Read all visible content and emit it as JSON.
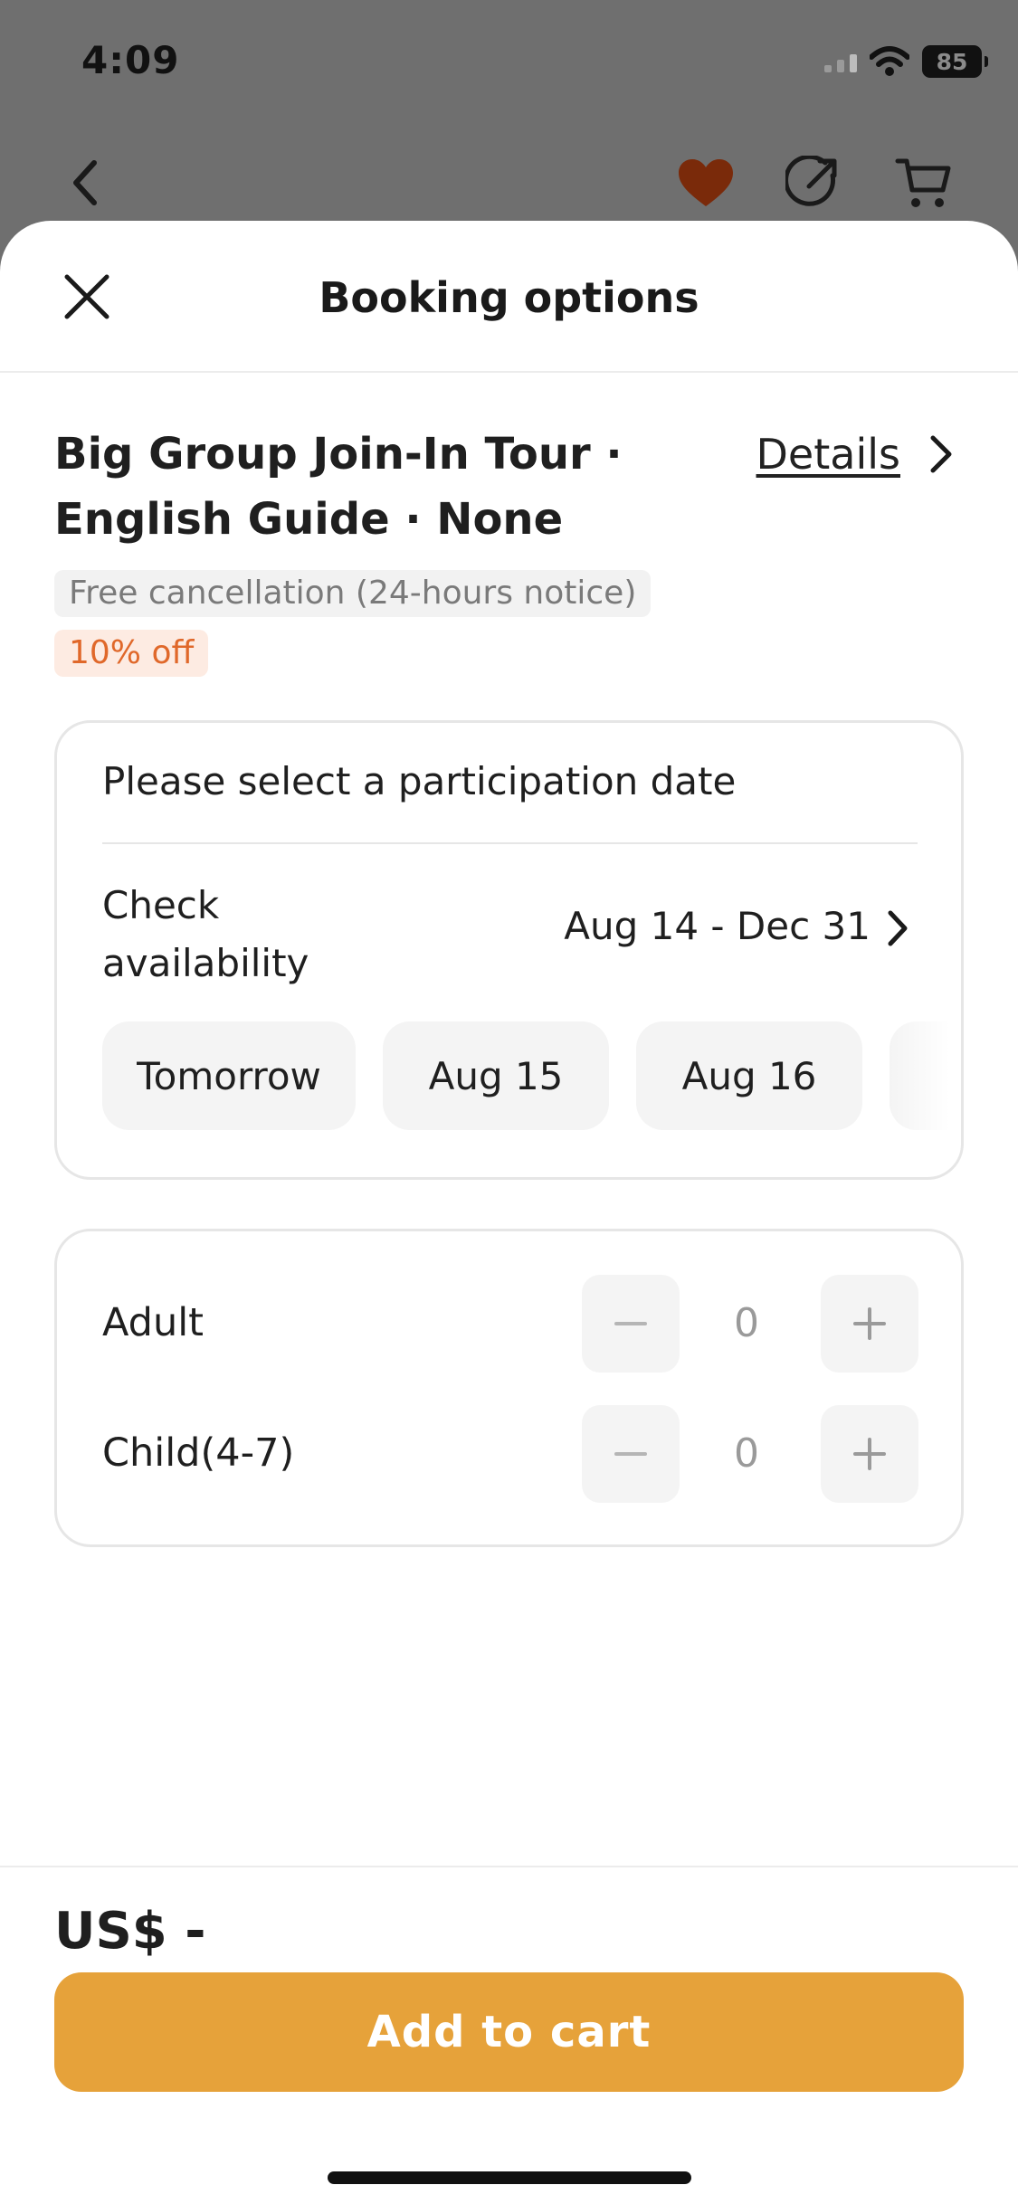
{
  "status_bar": {
    "time": "4:09",
    "battery": "85"
  },
  "nav": {
    "back_icon": "chevron-left-icon",
    "favorite_icon": "heart-icon",
    "share_icon": "share-icon",
    "cart_icon": "cart-icon",
    "favorite_color": "#7a2a0a"
  },
  "sheet": {
    "title": "Booking options",
    "close_icon": "close-icon"
  },
  "package": {
    "title_line1": "Big Group Join-In Tour ·",
    "title_line2": "English Guide · None",
    "details_label": "Details",
    "cancellation_tag": "Free cancellation (24-hours notice)",
    "discount_tag": "10% off"
  },
  "date_card": {
    "prompt": "Please select a participation date",
    "check_label": "Check availability",
    "range": "Aug 14 - Dec 31",
    "chips": [
      {
        "label": "Tomorrow"
      },
      {
        "label": "Aug 15"
      },
      {
        "label": "Aug 16"
      }
    ]
  },
  "quantity_card": {
    "rows": [
      {
        "label": "Adult",
        "value": "0"
      },
      {
        "label": "Child(4-7)",
        "value": "0"
      }
    ]
  },
  "footer": {
    "price": "US$ -",
    "add_to_cart": "Add to cart",
    "button_color": "#e6a23a"
  }
}
